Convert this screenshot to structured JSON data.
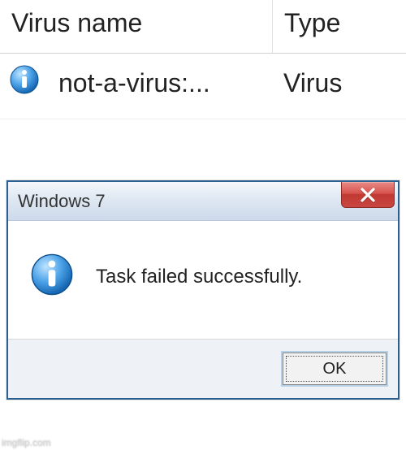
{
  "table": {
    "headers": {
      "name": "Virus name",
      "type": "Type"
    },
    "row": {
      "name": "not-a-virus:...",
      "type": "Virus",
      "icon": "info-icon"
    }
  },
  "dialog": {
    "title": "Windows 7",
    "message": "Task failed successfully.",
    "ok_label": "OK",
    "icon": "info-icon",
    "close_icon": "close-icon"
  },
  "watermark": "imgflip.com"
}
